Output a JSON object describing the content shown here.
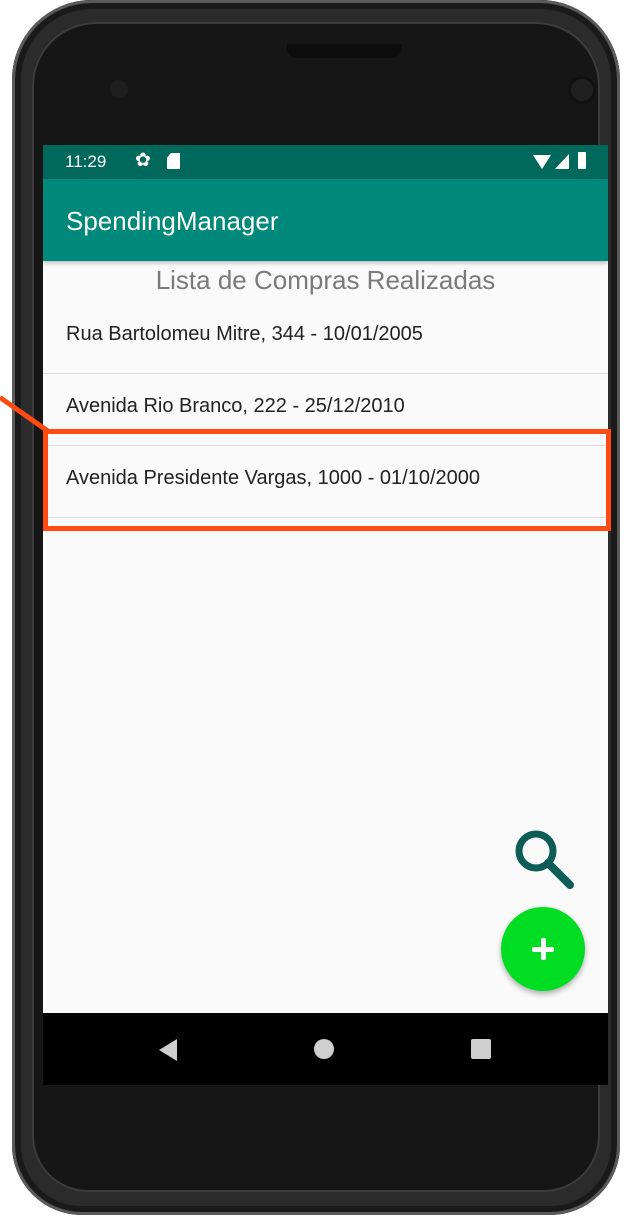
{
  "status_bar": {
    "time": "11:29",
    "icons": [
      "gear-icon",
      "sd-card-icon",
      "wifi-icon",
      "signal-icon",
      "battery-icon"
    ]
  },
  "app_bar": {
    "title": "SpendingManager",
    "color": "#00897b",
    "status_color": "#00695c"
  },
  "list": {
    "title": "Lista de Compras Realizadas",
    "items": [
      {
        "label": "Rua Bartolomeu Mitre, 344 - 10/01/2005"
      },
      {
        "label": "Avenida Rio Branco, 222 - 25/12/2010"
      },
      {
        "label": "Avenida Presidente Vargas, 1000 - 01/10/2000"
      }
    ]
  },
  "fabs": {
    "search_icon": "search-icon",
    "add_icon": "plus-icon",
    "add_color": "#00dd22"
  },
  "nav_bar": {
    "icons": [
      "back-icon",
      "home-icon",
      "recents-icon"
    ]
  },
  "annotation": {
    "color": "#ff4a12",
    "highlighted_item": 2
  }
}
